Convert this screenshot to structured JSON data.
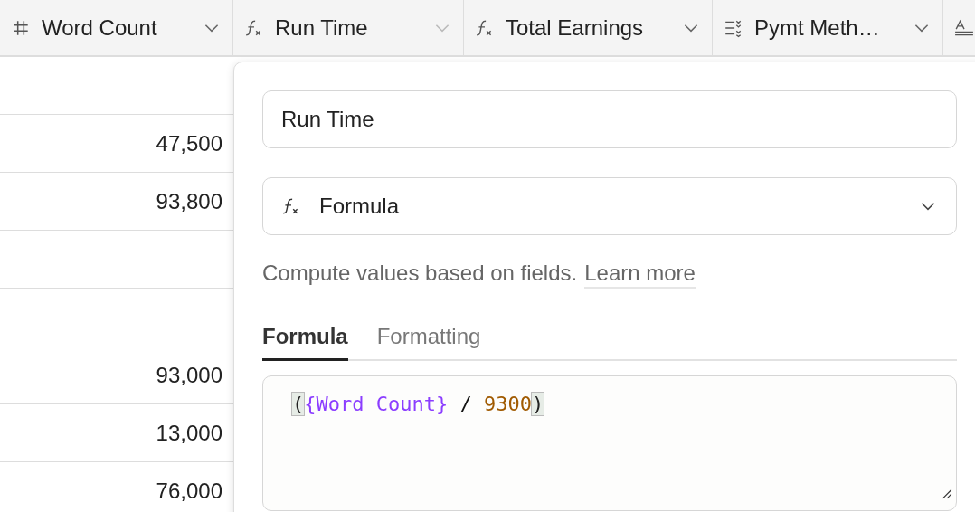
{
  "columns": [
    {
      "name": "Word Count",
      "kind": "number",
      "editing": false
    },
    {
      "name": "Run Time",
      "kind": "formula",
      "editing": true
    },
    {
      "name": "Total Earnings",
      "kind": "formula",
      "editing": false
    },
    {
      "name": "Pymt Meth…",
      "kind": "select",
      "editing": false
    },
    {
      "kind": "text"
    }
  ],
  "rows": [
    {},
    {
      "word_count": "47,500"
    },
    {
      "word_count": "93,800"
    },
    {},
    {},
    {
      "word_count": "93,000"
    },
    {
      "word_count": "13,000"
    },
    {
      "word_count": "76,000"
    }
  ],
  "editor": {
    "field_name": "Run Time",
    "field_type": {
      "kind": "formula",
      "label": "Formula"
    },
    "description": "Compute values based on fields.",
    "link": "Learn more",
    "tabs": [
      {
        "label": "Formula",
        "selected": true
      },
      {
        "label": "Formatting",
        "selected": false
      }
    ],
    "formula": [
      {
        "kind": "bracket",
        "text": "("
      },
      {
        "kind": "field",
        "text": "{Word Count}"
      },
      {
        "kind": "operator",
        "text": " / "
      },
      {
        "kind": "number",
        "text": "9300"
      },
      {
        "kind": "bracket",
        "text": ")"
      }
    ]
  }
}
